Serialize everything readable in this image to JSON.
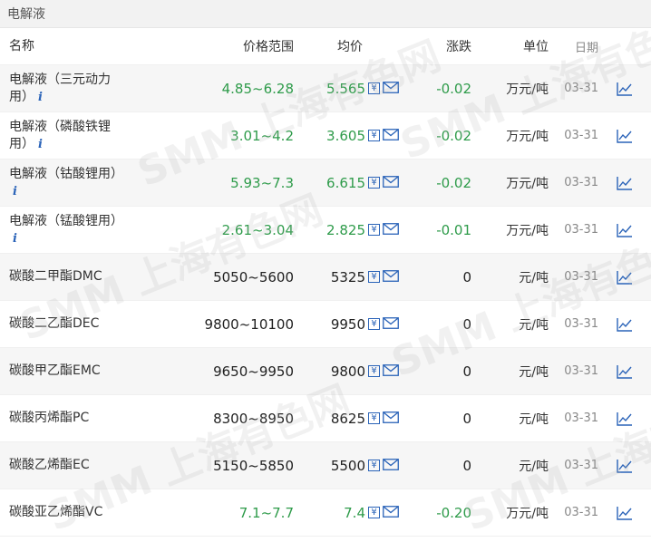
{
  "title": "电解液",
  "columns": {
    "name": "名称",
    "range": "价格范围",
    "avg": "均价",
    "change": "涨跌",
    "unit": "单位",
    "date": "日期"
  },
  "rows": [
    {
      "name_line1": "电解液（三元动力",
      "name_line2": "用）",
      "info": "i",
      "range": "4.85~6.28",
      "avg": "5.565",
      "change": "-0.02",
      "unit": "万元/吨",
      "date": "03-31",
      "color": "green"
    },
    {
      "name_line1": "电解液（磷酸铁锂",
      "name_line2": "用）",
      "info": "i",
      "range": "3.01~4.2",
      "avg": "3.605",
      "change": "-0.02",
      "unit": "万元/吨",
      "date": "03-31",
      "color": "green"
    },
    {
      "name_line1": "电解液（钴酸锂用）",
      "name_line2": "",
      "info": "i",
      "range": "5.93~7.3",
      "avg": "6.615",
      "change": "-0.02",
      "unit": "万元/吨",
      "date": "03-31",
      "color": "green"
    },
    {
      "name_line1": "电解液（锰酸锂用）",
      "name_line2": "",
      "info": "i",
      "range": "2.61~3.04",
      "avg": "2.825",
      "change": "-0.01",
      "unit": "万元/吨",
      "date": "03-31",
      "color": "green"
    },
    {
      "name_line1": "碳酸二甲酯DMC",
      "name_line2": "",
      "info": "",
      "range": "5050~5600",
      "avg": "5325",
      "change": "0",
      "unit": "元/吨",
      "date": "03-31",
      "color": "black"
    },
    {
      "name_line1": "碳酸二乙酯DEC",
      "name_line2": "",
      "info": "",
      "range": "9800~10100",
      "avg": "9950",
      "change": "0",
      "unit": "元/吨",
      "date": "03-31",
      "color": "black"
    },
    {
      "name_line1": "碳酸甲乙酯EMC",
      "name_line2": "",
      "info": "",
      "range": "9650~9950",
      "avg": "9800",
      "change": "0",
      "unit": "元/吨",
      "date": "03-31",
      "color": "black"
    },
    {
      "name_line1": "碳酸丙烯酯PC",
      "name_line2": "",
      "info": "",
      "range": "8300~8950",
      "avg": "8625",
      "change": "0",
      "unit": "元/吨",
      "date": "03-31",
      "color": "black"
    },
    {
      "name_line1": "碳酸乙烯酯EC",
      "name_line2": "",
      "info": "",
      "range": "5150~5850",
      "avg": "5500",
      "change": "0",
      "unit": "元/吨",
      "date": "03-31",
      "color": "black"
    },
    {
      "name_line1": "碳酸亚乙烯酯VC",
      "name_line2": "",
      "info": "",
      "range": "7.1~7.7",
      "avg": "7.4",
      "change": "-0.20",
      "unit": "万元/吨",
      "date": "03-31",
      "color": "green"
    }
  ],
  "icons": {
    "yen": "yen-icon",
    "mail": "mail-icon",
    "trend": "trend-chart-icon"
  },
  "colors": {
    "down": "#2e9b4a",
    "neutral": "#222222",
    "link": "#2a63b8"
  },
  "watermark_text": "SMM 上海有色网"
}
